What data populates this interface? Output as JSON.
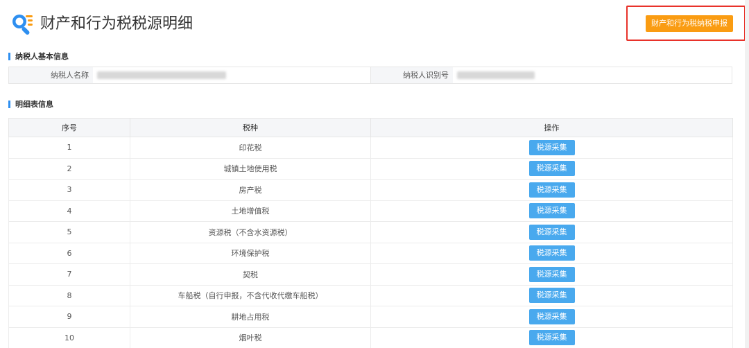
{
  "header": {
    "title": "财产和行为税税源明细",
    "declare_button": "财产和行为税纳税申报",
    "icon": "search-list-icon",
    "accent_color": "#fa9c12",
    "highlight_color": "#e8322a"
  },
  "taxpayer_section": {
    "title": "纳税人基本信息",
    "name_label": "纳税人名称",
    "id_label": "纳税人识别号"
  },
  "detail_section": {
    "title": "明细表信息",
    "columns": [
      "序号",
      "税种",
      "操作"
    ],
    "action_label": "税源采集",
    "rows": [
      {
        "no": "1",
        "tax": "印花税"
      },
      {
        "no": "2",
        "tax": "城镇土地使用税"
      },
      {
        "no": "3",
        "tax": "房产税"
      },
      {
        "no": "4",
        "tax": "土地增值税"
      },
      {
        "no": "5",
        "tax": "资源税（不含水资源税）"
      },
      {
        "no": "6",
        "tax": "环境保护税"
      },
      {
        "no": "7",
        "tax": "契税"
      },
      {
        "no": "8",
        "tax": "车船税（自行申报，不含代收代缴车船税）"
      },
      {
        "no": "9",
        "tax": "耕地占用税"
      },
      {
        "no": "10",
        "tax": "烟叶税"
      }
    ],
    "button_color": "#49a9ee"
  }
}
